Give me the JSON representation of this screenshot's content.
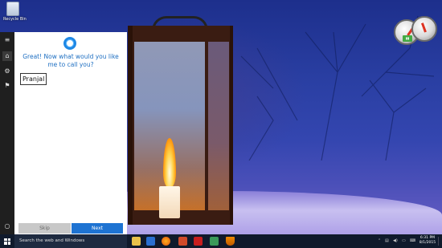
{
  "desktop": {
    "recycle_bin_label": "Recycle Bin"
  },
  "cortana": {
    "question": "Great! Now what would you like me to call you?",
    "name_value": "Pranjal",
    "skip_label": "Skip",
    "next_label": "Next",
    "accent_color": "#1e73d2"
  },
  "rail": {
    "icons": [
      "hamburger-icon",
      "home-icon",
      "settings-icon",
      "feedback-icon",
      "microphone-icon"
    ]
  },
  "taskbar": {
    "search_placeholder": "Search the web and Windows",
    "time": "6:31 PM",
    "date": "8/1/2015",
    "pinned": [
      "file-explorer-icon",
      "store-icon",
      "firefox-icon",
      "paint-icon",
      "acrobat-icon",
      "photo-icon",
      "tool-icon",
      "vlc-icon"
    ]
  }
}
